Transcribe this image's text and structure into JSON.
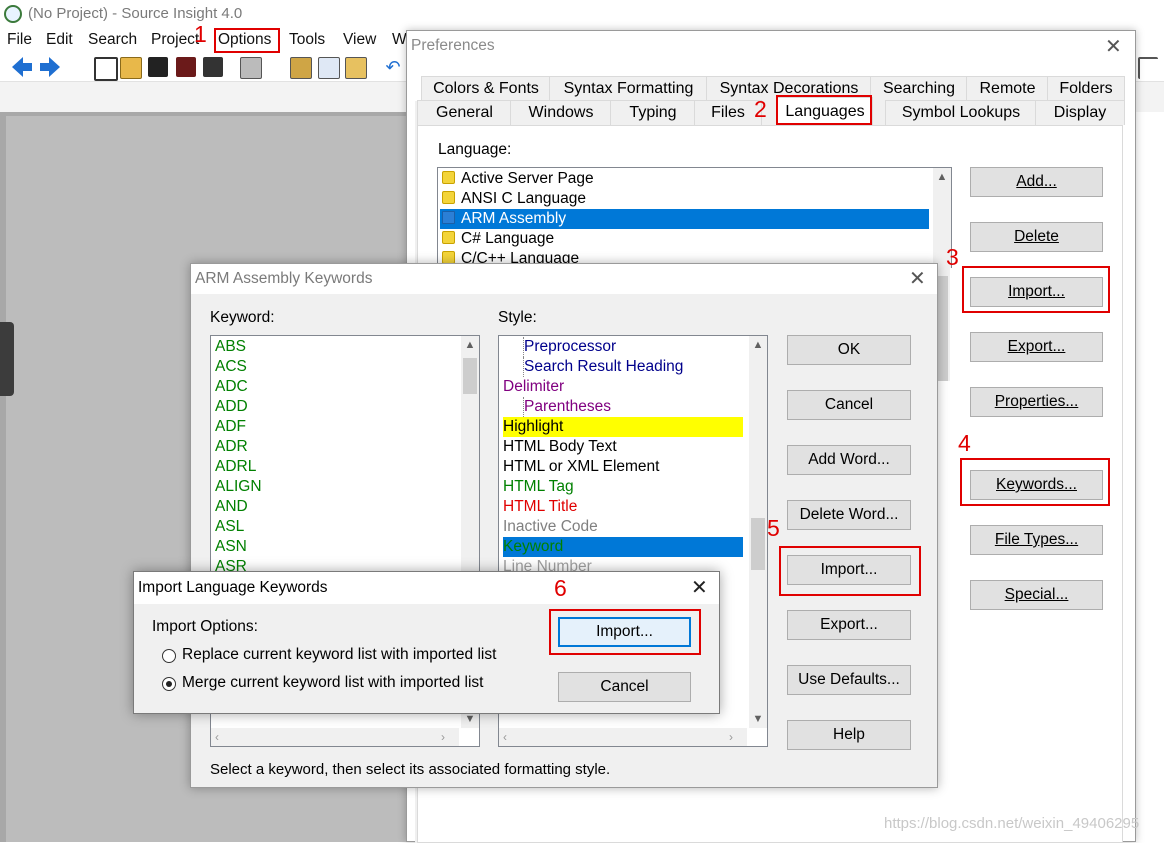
{
  "app": {
    "title": "(No Project) - Source Insight 4.0",
    "menu": [
      "File",
      "Edit",
      "Search",
      "Project",
      "Options",
      "Tools",
      "View",
      "W"
    ]
  },
  "preferences": {
    "title": "Preferences",
    "tabs_row1": [
      "Colors & Fonts",
      "Syntax Formatting",
      "Syntax Decorations",
      "Searching",
      "Remote",
      "Folders"
    ],
    "tabs_row2": [
      "General",
      "Windows",
      "Typing",
      "Files",
      "Languages",
      "Symbol Lookups",
      "Display"
    ],
    "active_tab": "Languages",
    "language_label": "Language:",
    "languages": [
      "Active Server Page",
      "ANSI C Language",
      "ARM Assembly",
      "C# Language",
      "C/C++ Language"
    ],
    "selected_language": "ARM Assembly",
    "buttons": {
      "add": "Add...",
      "delete": "Delete",
      "import": "Import...",
      "export": "Export...",
      "properties": "Properties...",
      "keywords": "Keywords...",
      "file_types": "File Types...",
      "special": "Special..."
    }
  },
  "arm_dialog": {
    "title": "ARM Assembly Keywords",
    "keyword_label": "Keyword:",
    "style_label": "Style:",
    "keywords": [
      "ABS",
      "ACS",
      "ADC",
      "ADD",
      "ADF",
      "ADR",
      "ADRL",
      "ALIGN",
      "AND",
      "ASL",
      "ASN",
      "ASR"
    ],
    "styles": [
      {
        "text": "Preprocessor",
        "color": "#00008b",
        "indent": true
      },
      {
        "text": "Search Result Heading",
        "color": "#00008b",
        "indent": true
      },
      {
        "text": "Delimiter",
        "color": "#800080",
        "indent": false
      },
      {
        "text": "Parentheses",
        "color": "#800080",
        "indent": true
      },
      {
        "text": "Highlight",
        "color": "#000000",
        "indent": false,
        "bg": "#ffff00"
      },
      {
        "text": "HTML Body Text",
        "color": "#000000",
        "indent": false
      },
      {
        "text": "HTML or XML Element",
        "color": "#000000",
        "indent": false
      },
      {
        "text": "HTML Tag",
        "color": "#008000",
        "indent": false
      },
      {
        "text": "HTML Title",
        "color": "#e00000",
        "indent": false
      },
      {
        "text": "Inactive Code",
        "color": "#808080",
        "indent": false
      },
      {
        "text": "Keyword",
        "color": "#008000",
        "indent": false,
        "bg": "#0078d7"
      },
      {
        "text": "Line Number",
        "color": "#a0a0a0",
        "indent": false
      }
    ],
    "buttons": {
      "ok": "OK",
      "cancel": "Cancel",
      "add_word": "Add Word...",
      "delete_word": "Delete Word...",
      "import": "Import...",
      "export": "Export...",
      "use_defaults": "Use Defaults...",
      "help": "Help"
    },
    "hint": "Select a keyword, then select its associated formatting style."
  },
  "import_dialog": {
    "title": "Import Language Keywords",
    "options_label": "Import Options:",
    "option_replace": "Replace current keyword list with imported list",
    "option_merge": "Merge current keyword list with imported list",
    "selected_option": "merge",
    "import_button": "Import...",
    "cancel_button": "Cancel"
  },
  "annotations": [
    "1",
    "2",
    "3",
    "4",
    "5",
    "6"
  ],
  "watermark": "https://blog.csdn.net/weixin_49406295",
  "colors": {
    "annotation_red": "#e00000",
    "selection_blue": "#0078d7",
    "keyword_green": "#008000"
  }
}
